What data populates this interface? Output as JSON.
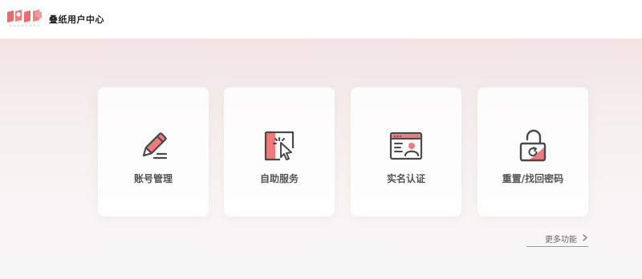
{
  "header": {
    "title": "叠纸用户中心",
    "logo_icon": "papergames-logo-icon"
  },
  "cards": [
    {
      "label": "账号管理",
      "icon": "pencil-icon"
    },
    {
      "label": "自助服务",
      "icon": "self-service-click-icon"
    },
    {
      "label": "实名认证",
      "icon": "id-card-icon"
    },
    {
      "label": "重置/找回密码",
      "icon": "unlock-refresh-icon"
    }
  ],
  "more": {
    "label": "更多功能"
  },
  "colors": {
    "accent": "#ef7a79",
    "icon_stroke": "#4a4a4a",
    "text": "#555555"
  }
}
